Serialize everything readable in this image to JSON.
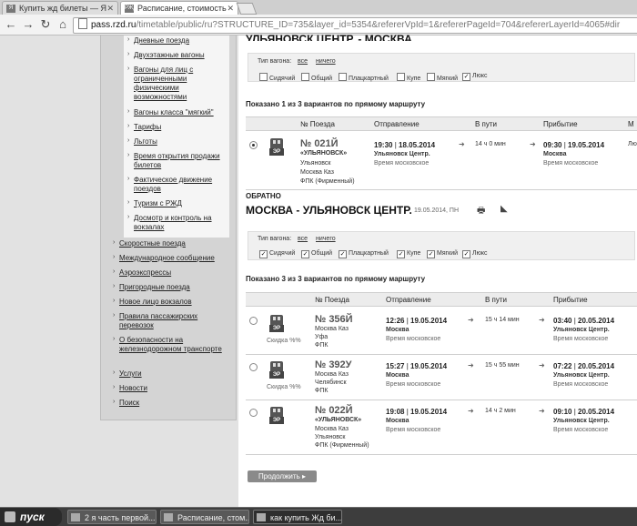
{
  "browser": {
    "tabs": [
      {
        "label": "Купить жд билеты — Я",
        "favicon": "yandex-favicon"
      },
      {
        "label": "Расписание, стоимость",
        "favicon": "rzd-favicon"
      }
    ],
    "url_host": "pass.rzd.ru",
    "url_path": "/timetable/public/ru?STRUCTURE_ID=735&layer_id=5354&refererVpId=1&refererPageId=704&refererLayerId=4065#dir"
  },
  "sidebar": {
    "inner_items": [
      "Дневные поезда",
      "Двухэтажные вагоны",
      "Вагоны для лиц с ограниченными физическими возможностями",
      "Вагоны класса \"мягкий\"",
      "Тарифы",
      "Льготы",
      "Время открытия продажи билетов",
      "Фактическое движение поездов",
      "Туризм с РЖД",
      "Досмотр и контроль на вокзалах"
    ],
    "outer_items": [
      "Скоростные поезда",
      "Международное сообщение",
      "Аэроэкспрессы",
      "Пригородные поезда",
      "Новое лицо вокзалов",
      "Правила пассажирских перевозок",
      "О безопасности на железнодорожном транспорте",
      "Услуги",
      "Новости",
      "Поиск"
    ]
  },
  "outbound": {
    "route_title": "УЛЬЯНОВСК ЦЕНТР. - МОСКВА",
    "filter": {
      "label": "Тип вагона:",
      "all": "все",
      "none": "ничего",
      "options": [
        {
          "label": "Сидячий",
          "checked": false
        },
        {
          "label": "Общий",
          "checked": false
        },
        {
          "label": "Плацкартный",
          "checked": false
        },
        {
          "label": "Купе",
          "checked": false
        },
        {
          "label": "Мягкий",
          "checked": false
        },
        {
          "label": "Люкс",
          "checked": true
        }
      ]
    },
    "shown": "Показано 1 из 3 вариантов по прямому маршруту",
    "columns": [
      "№ Поезда",
      "Отправление",
      "В пути",
      "Прибытие",
      "М"
    ],
    "trains": [
      {
        "code": "ЭР",
        "number": "№ 021Й",
        "name": "«УЛЬЯНОВСК»",
        "route_from": "Ульяновск",
        "route_to": "Москва Каз",
        "carrier": "ФПК (Фирменный)",
        "dep_time": "19:30",
        "dep_date": "18.05.2014",
        "dep_station": "Ульяновск Центр.",
        "dep_tz": "Время московское",
        "duration": "14 ч 0 мин",
        "arr_time": "09:30",
        "arr_date": "19.05.2014",
        "arr_station": "Москва",
        "arr_tz": "Время московское",
        "extra": "Лю",
        "selected": true
      }
    ]
  },
  "return": {
    "label": "ОБРАТНО",
    "route_title": "МОСКВА - УЛЬЯНОВСК ЦЕНТР.",
    "date": "19.05.2014, ПН",
    "filter": {
      "label": "Тип вагона:",
      "all": "все",
      "none": "ничего",
      "options": [
        {
          "label": "Сидячий",
          "checked": true
        },
        {
          "label": "Общий",
          "checked": true
        },
        {
          "label": "Плацкартный",
          "checked": true
        },
        {
          "label": "Купе",
          "checked": true
        },
        {
          "label": "Мягкий",
          "checked": true
        },
        {
          "label": "Люкс",
          "checked": true
        }
      ]
    },
    "shown": "Показано 3 из 3 вариантов по прямому маршруту",
    "columns": [
      "№ Поезда",
      "Отправление",
      "В пути",
      "Прибытие"
    ],
    "trains": [
      {
        "code": "ЭР",
        "discount": "Скидка %%",
        "number": "№ 356Й",
        "name": "",
        "route_from": "Москва Каз",
        "route_to": "Уфа",
        "carrier": "ФПК",
        "dep_time": "12:26",
        "dep_date": "19.05.2014",
        "dep_station": "Москва",
        "dep_tz": "Время московское",
        "duration": "15 ч 14 мин",
        "arr_time": "03:40",
        "arr_date": "20.05.2014",
        "arr_station": "Ульяновск Центр.",
        "arr_tz": "Время московское"
      },
      {
        "code": "ЭР",
        "discount": "Скидка %%",
        "number": "№ 392У",
        "name": "",
        "route_from": "Москва Каз",
        "route_to": "Челябинск",
        "carrier": "ФПК",
        "dep_time": "15:27",
        "dep_date": "19.05.2014",
        "dep_station": "Москва",
        "dep_tz": "Время московское",
        "duration": "15 ч 55 мин",
        "arr_time": "07:22",
        "arr_date": "20.05.2014",
        "arr_station": "Ульяновск Центр.",
        "arr_tz": "Время московское"
      },
      {
        "code": "ЭР",
        "discount": "",
        "number": "№ 022Й",
        "name": "«УЛЬЯНОВСК»",
        "route_from": "Москва Каз",
        "route_to": "Ульяновск",
        "carrier": "ФПК (Фирменный)",
        "dep_time": "19:08",
        "dep_date": "19.05.2014",
        "dep_station": "Москва",
        "dep_tz": "Время московское",
        "duration": "14 ч 2 мин",
        "arr_time": "09:10",
        "arr_date": "20.05.2014",
        "arr_station": "Ульяновск Центр.",
        "arr_tz": "Время московское"
      }
    ],
    "continue_label": "Продолжить"
  },
  "taskbar": {
    "start": "пуск",
    "tasks": [
      "2 я часть первой...",
      "Расписание, стом...",
      "как купить Жд би..."
    ]
  }
}
